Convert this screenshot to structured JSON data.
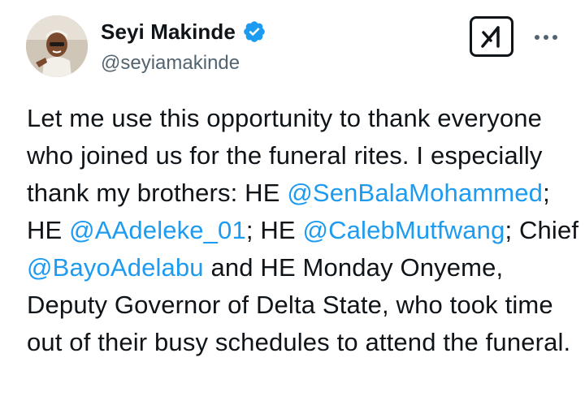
{
  "author": {
    "display_name": "Seyi Makinde",
    "handle": "@seyiamakinde",
    "verified": true,
    "avatar_icon": "profile-photo"
  },
  "actions": {
    "grok_icon": "grok-icon",
    "more_icon": "more-options-icon"
  },
  "colors": {
    "text": "#0f1419",
    "muted": "#536471",
    "link": "#1d9bf0",
    "verified": "#1d9bf0"
  },
  "tweet": {
    "segments": [
      {
        "text": "Let me use this opportunity to thank everyone who joined us for the funeral rites. I especially thank my brothers: HE "
      },
      {
        "mention": "@SenBalaMohammed"
      },
      {
        "text": "; HE "
      },
      {
        "mention": "@AAdeleke_01"
      },
      {
        "text": "; HE "
      },
      {
        "mention": "@CalebMutfwang"
      },
      {
        "text": "; Chief "
      },
      {
        "mention": "@BayoAdelabu"
      },
      {
        "text": " and HE Monday Onyeme, Deputy Governor of Delta State, who took time out of their busy schedules to attend the funeral."
      }
    ]
  }
}
